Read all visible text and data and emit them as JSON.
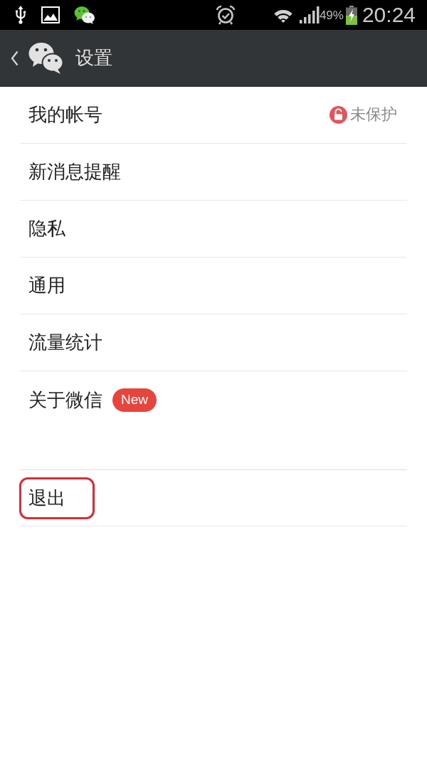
{
  "status_bar": {
    "battery": "49%",
    "time": "20:24"
  },
  "header": {
    "title": "设置"
  },
  "sections": [
    {
      "items": [
        {
          "label": "我的帐号",
          "status": "未保护",
          "highlighted": false
        },
        {
          "label": "新消息提醒",
          "highlighted": false
        },
        {
          "label": "隐私",
          "highlighted": false
        },
        {
          "label": "通用",
          "highlighted": false
        },
        {
          "label": "流量统计",
          "highlighted": false
        },
        {
          "label": "关于微信",
          "badge": "New",
          "highlighted": false
        }
      ]
    },
    {
      "items": [
        {
          "label": "退出",
          "highlighted": true
        }
      ]
    }
  ]
}
